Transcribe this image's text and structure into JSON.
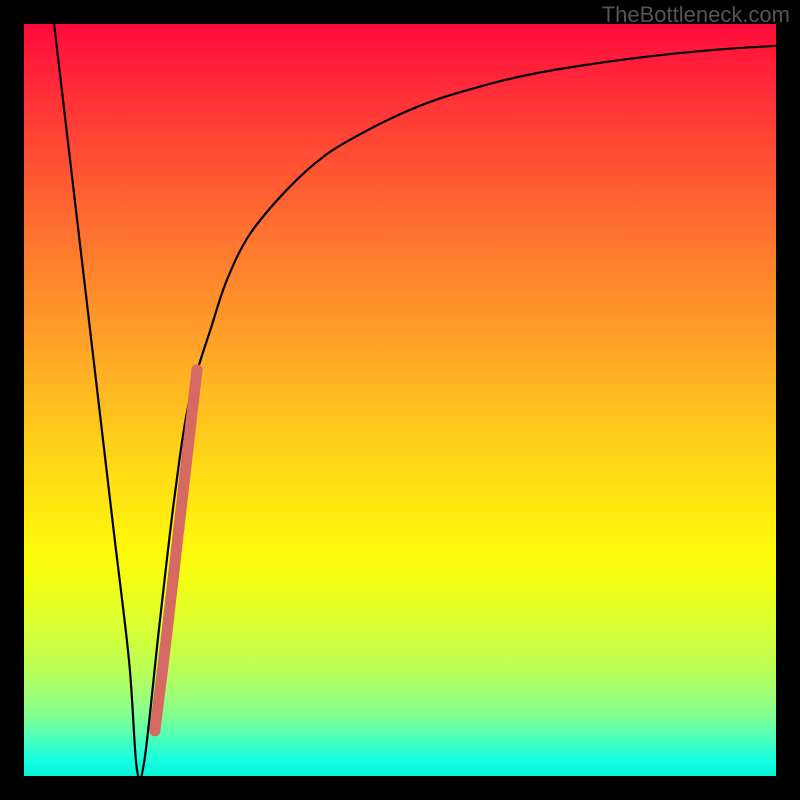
{
  "watermark": "TheBottleneck.com",
  "chart_data": {
    "type": "line",
    "title": "",
    "xlabel": "",
    "ylabel": "",
    "xlim": [
      0,
      100
    ],
    "ylim": [
      0,
      100
    ],
    "series": [
      {
        "name": "bottleneck-curve",
        "x": [
          4,
          6,
          8,
          10,
          12,
          14,
          15,
          16,
          18,
          20,
          22,
          25,
          27,
          30,
          35,
          40,
          45,
          50,
          55,
          60,
          65,
          70,
          75,
          80,
          85,
          90,
          95,
          100
        ],
        "values": [
          100,
          83,
          66,
          49,
          32,
          15,
          1,
          2,
          20,
          37,
          50,
          60,
          66,
          72,
          78,
          82.5,
          85.5,
          88,
          90,
          91.5,
          92.8,
          93.8,
          94.6,
          95.3,
          95.9,
          96.4,
          96.8,
          97.1
        ]
      }
    ],
    "markers": {
      "name": "highlight-dots",
      "color": "#d46a62",
      "points": [
        {
          "x": 17.4,
          "y": 6
        },
        {
          "x": 17.9,
          "y": 10
        },
        {
          "x": 18.4,
          "y": 14
        },
        {
          "x": 19.0,
          "y": 19
        },
        {
          "x": 19.8,
          "y": 26
        },
        {
          "x": 20.6,
          "y": 33
        },
        {
          "x": 21.4,
          "y": 40
        },
        {
          "x": 22.2,
          "y": 47
        },
        {
          "x": 23.0,
          "y": 54
        }
      ]
    },
    "gradient_stops": [
      {
        "pos": 0,
        "color": "#ff0a3a"
      },
      {
        "pos": 50,
        "color": "#ffd01a"
      },
      {
        "pos": 75,
        "color": "#f3ff12"
      },
      {
        "pos": 100,
        "color": "#06f3d4"
      }
    ]
  }
}
